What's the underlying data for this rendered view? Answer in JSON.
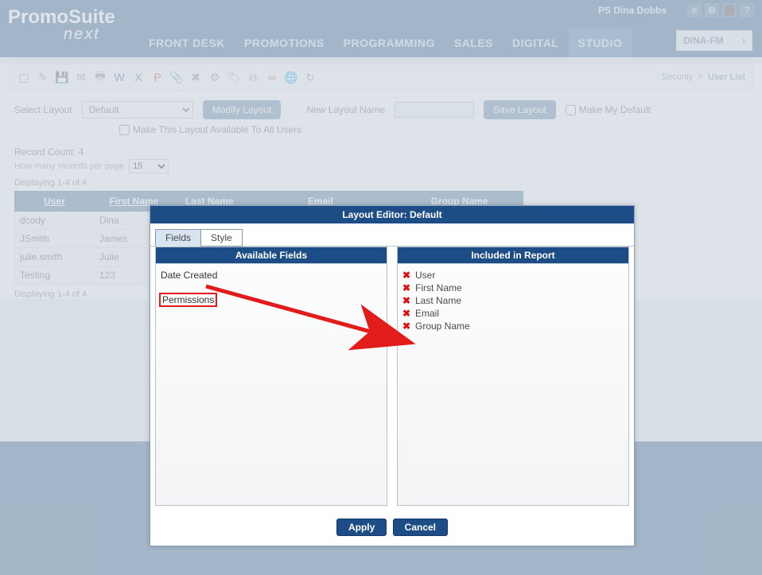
{
  "header": {
    "logo_main": "PromoSuite",
    "logo_sub": "next",
    "user": "PS Dina Dobbs",
    "station": "DINA-FM",
    "nav": [
      "FRONT DESK",
      "PROMOTIONS",
      "PROGRAMMING",
      "SALES",
      "DIGITAL",
      "STUDIO"
    ],
    "nav_active": 5
  },
  "breadcrumb": {
    "a": "Security",
    "b": "User List"
  },
  "layoutbar": {
    "select_label": "Select Layout",
    "select_value": "Default",
    "modify_btn": "Modify Layout",
    "new_label": "New Layout Name",
    "save_btn": "Save Layout",
    "make_default": "Make My Default",
    "make_avail": "Make This Layout Available To All Users"
  },
  "counts": {
    "record_count": "Record Count: 4",
    "perpage_label": "How many records per page",
    "perpage_value": "15",
    "displaying": "Displaying 1-4 of 4"
  },
  "grid": {
    "headers": [
      "User",
      "First Name",
      "Last Name",
      "Email",
      "Group Name"
    ],
    "rows": [
      [
        "dcody",
        "Dina",
        "",
        "",
        ""
      ],
      [
        "JSmith",
        "James",
        "",
        "",
        ""
      ],
      [
        "julie.smith",
        "Julie",
        "",
        "",
        ""
      ],
      [
        "Testing",
        "123",
        "",
        "",
        ""
      ]
    ]
  },
  "modal": {
    "title": "Layout Editor: Default",
    "tabs": [
      "Fields",
      "Style"
    ],
    "active_tab": 0,
    "left_head": "Available Fields",
    "right_head": "Included in Report",
    "available": [
      "Date Created",
      "Permissions"
    ],
    "highlight_index": 1,
    "included": [
      "User",
      "First Name",
      "Last Name",
      "Email",
      "Group Name"
    ],
    "apply": "Apply",
    "cancel": "Cancel"
  }
}
